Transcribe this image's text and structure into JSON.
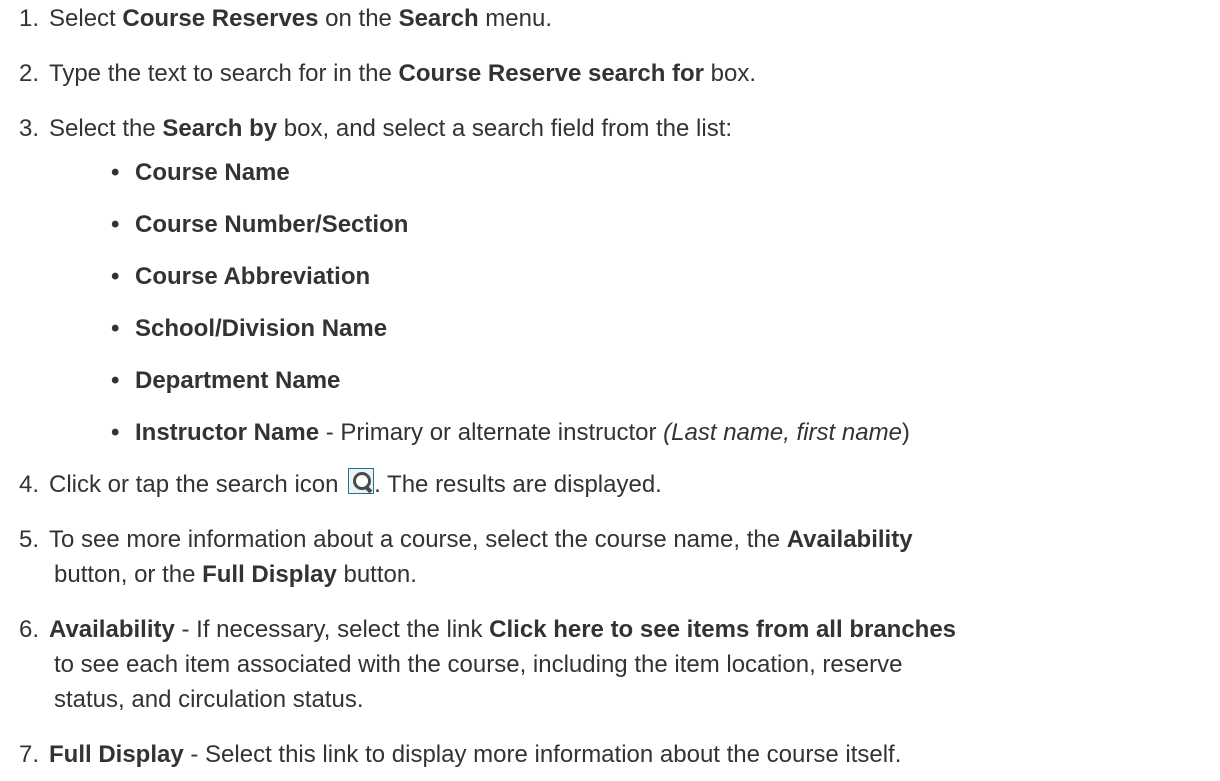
{
  "steps": [
    {
      "num": "1.",
      "t1": "Select ",
      "b1": "Course Reserves",
      "t2": " on the ",
      "b2": "Search",
      "t3": " menu."
    },
    {
      "num": "2.",
      "t1": "Type the text to search for in the ",
      "b1": "Course Reserve search for",
      "t2": " box."
    },
    {
      "num": "3.",
      "t1": "Select the ",
      "b1": "Search by",
      "t2": " box, and select a search field from the list:"
    },
    {
      "num": "4.",
      "t1": "Click or tap the search icon ",
      "t2": ". The results are displayed."
    },
    {
      "num": "5.",
      "t1": "To see more information about a course, select the course name, the ",
      "b1": "Availability",
      "t2": "button, or the ",
      "b2": "Full Display",
      "t3": " button."
    },
    {
      "num": "6.",
      "b1": "Availability",
      "t1": " - If necessary, select the link ",
      "b2": "Click here to see items from all branches",
      "t2": "to see each item associated with the course, including the item location, reserve",
      "t3": "status, and circulation status."
    },
    {
      "num": "7.",
      "b1": "Full Display",
      "t1": " - Select this link to display more information about the course itself."
    }
  ],
  "search_fields": [
    {
      "label": "Course Name"
    },
    {
      "label": "Course Number/Section"
    },
    {
      "label": "Course Abbreviation"
    },
    {
      "label": "School/Division Name"
    },
    {
      "label": "Department Name"
    },
    {
      "label": "Instructor Name",
      "desc_prefix": " - Primary or alternate instructor ",
      "desc_paren_open": "(",
      "desc_italic": "Last name, first name",
      "desc_paren_close": ")"
    }
  ],
  "bullet_char": "•",
  "icons": {
    "search": "search-icon"
  },
  "colors": {
    "text": "#333333",
    "icon_border": "#2c6e8e"
  }
}
